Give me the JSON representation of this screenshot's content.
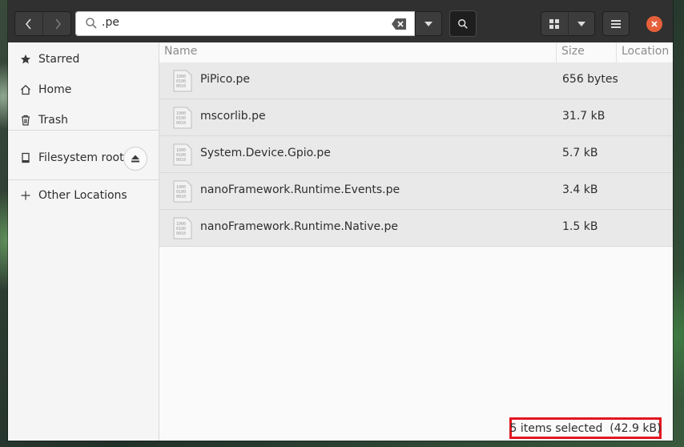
{
  "search": {
    "query": ".pe"
  },
  "sidebar": {
    "items": [
      {
        "label": "Starred",
        "icon": "star-icon"
      },
      {
        "label": "Home",
        "icon": "home-icon"
      },
      {
        "label": "Trash",
        "icon": "trash-icon"
      },
      {
        "label": "Filesystem root",
        "icon": "drive-icon"
      },
      {
        "label": "Other Locations",
        "icon": "plus-icon"
      }
    ]
  },
  "columns": {
    "name": "Name",
    "size": "Size",
    "location": "Location"
  },
  "files": [
    {
      "name": "PiPico.pe",
      "size": "656 bytes"
    },
    {
      "name": "mscorlib.pe",
      "size": "31.7 kB"
    },
    {
      "name": "System.Device.Gpio.pe",
      "size": "5.7 kB"
    },
    {
      "name": "nanoFramework.Runtime.Events.pe",
      "size": "3.4 kB"
    },
    {
      "name": "nanoFramework.Runtime.Native.pe",
      "size": "1.5 kB"
    }
  ],
  "status": {
    "text": "5 items selected  (42.9 kB)"
  },
  "colors": {
    "headerbar": "#303030",
    "close": "#e5603a",
    "highlight": "#e2161f"
  }
}
